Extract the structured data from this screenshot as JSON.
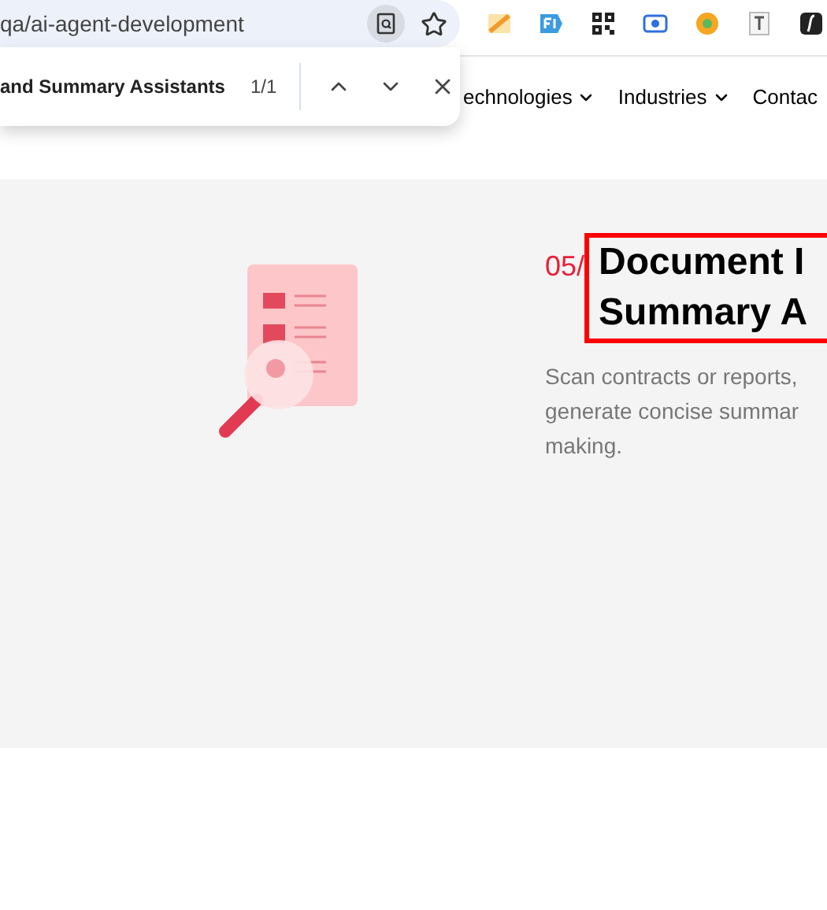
{
  "address_bar": {
    "url": "qa/ai-agent-development"
  },
  "find_bar": {
    "query": "and Summary Assistants",
    "count": "1/1"
  },
  "nav": {
    "items": [
      {
        "label": "echnologies"
      },
      {
        "label": "Industries"
      },
      {
        "label": "Contac"
      }
    ]
  },
  "section": {
    "number": "05/",
    "title_lines": [
      "Document I",
      "Summary A"
    ],
    "description": "Scan contracts or reports,\ngenerate concise summar\nmaking."
  }
}
